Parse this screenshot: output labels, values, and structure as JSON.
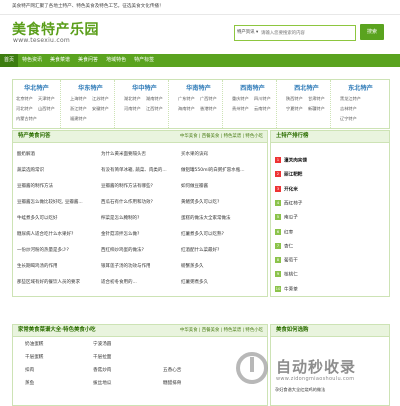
{
  "topbar": {
    "text": "美食特产网汇聚了各地土特产、特色美食及特色工艺。征选美食文化传播！"
  },
  "logo": {
    "cn": "美食特产乐园",
    "en": "www.tesexiu.com"
  },
  "search": {
    "category": "特产资讯 ▾",
    "placeholder": "请输入您要搜索的内容",
    "button": "搜索"
  },
  "nav": [
    "首页",
    "特色资讯",
    "美食菜谱",
    "美食问答",
    "地域特色",
    "特产标签"
  ],
  "regions": [
    {
      "title": "华北特产",
      "items": [
        "北京特产",
        "天津特产",
        "河北特产",
        "山西特产",
        "内蒙古特产"
      ]
    },
    {
      "title": "华东特产",
      "items": [
        "上海特产",
        "江苏特产",
        "浙江特产",
        "安徽特产",
        "福建特产"
      ]
    },
    {
      "title": "华中特产",
      "items": [
        "湖北特产",
        "湖南特产",
        "河南特产",
        "江西特产"
      ]
    },
    {
      "title": "华南特产",
      "items": [
        "广东特产",
        "广西特产",
        "海南特产",
        "香港特产"
      ]
    },
    {
      "title": "西南特产",
      "items": [
        "重庆特产",
        "四川特产",
        "贵州特产",
        "云南特产"
      ]
    },
    {
      "title": "西北特产",
      "items": [
        "陕西特产",
        "甘肃特产",
        "宁夏特产",
        "新疆特产"
      ]
    },
    {
      "title": "东北特产",
      "items": [
        "黑龙江特产",
        "吉林特产",
        "辽宁特产"
      ]
    }
  ],
  "qa": {
    "title": "特产美食问答",
    "tabs": "中华美食 | 西餐美食 | 特色菜谱 | 特色小吃",
    "rows": [
      [
        "酸奶解酒",
        "为什么黄米面要隔头否",
        "买水果的诀窍"
      ],
      [
        "蔬菜选购常识",
        "有没有简单冰箱, 蔬菜、肉类的...",
        "做铝罐550ml的白粥扩容水瓶..."
      ],
      [
        "豆瓣酱的制作方法",
        "豆瓣酱的制作方法有哪些?",
        "如何做豆瓣酱"
      ],
      [
        "豆瓣酱怎么做比较好吃, 豆瓣酱...",
        "西瓜石有什么作用和功效?",
        "黄鳝煲多久可以吃?"
      ],
      [
        "牛蛙煮多久可以吃好",
        "榨菜是怎么腌制的?",
        "蛋糕的做法大全家常做法"
      ],
      [
        "糖尿病人适合吃什么水果好?",
        "金针菇凉拌怎么做?",
        "红薯煮多久可以吃熟?"
      ],
      [
        "一份炒河粉的热量是多少?",
        "西红柿炒鸡蛋的做法?",
        "红酒配什么菜最好?"
      ],
      [
        "生长期喝鸡汤的作用",
        "银耳莲子汤的功效与作用",
        "螃蟹蒸多久"
      ],
      [
        "那些区域有好的餐饮人员的要求",
        "适合初冬食用的...",
        "红薯粥煮多久"
      ]
    ]
  },
  "rank": {
    "title": "土特产排行榜",
    "items": [
      "潼关肉夹馍",
      "丽江粑粑",
      "开化米",
      "西红柿子",
      "南瓜子",
      "红枣",
      "杏仁",
      "葡萄干",
      "核桃仁",
      "牛蒡茶"
    ]
  },
  "bottom": {
    "title": "家常美食菜谱大全·特色美食小吃",
    "tabs": "中华美食 | 西餐美食 | 特色菜谱 | 特色小吃",
    "items": [
      "奶油蛋糕",
      "宁波汤圆",
      "千层蛋糕",
      "千层拉面",
      "扣肉",
      "香菇炒肉",
      "蒸鱼",
      "拔丝地瓜",
      "五香心舌",
      "糖醋排骨"
    ],
    "side_title": "美食如何选购",
    "side_link": "孕妇食谱大全红烧鸡的做法"
  },
  "watermark": {
    "text": "自动秒收录",
    "url": "www.zidongmiaoshoulu.com"
  }
}
